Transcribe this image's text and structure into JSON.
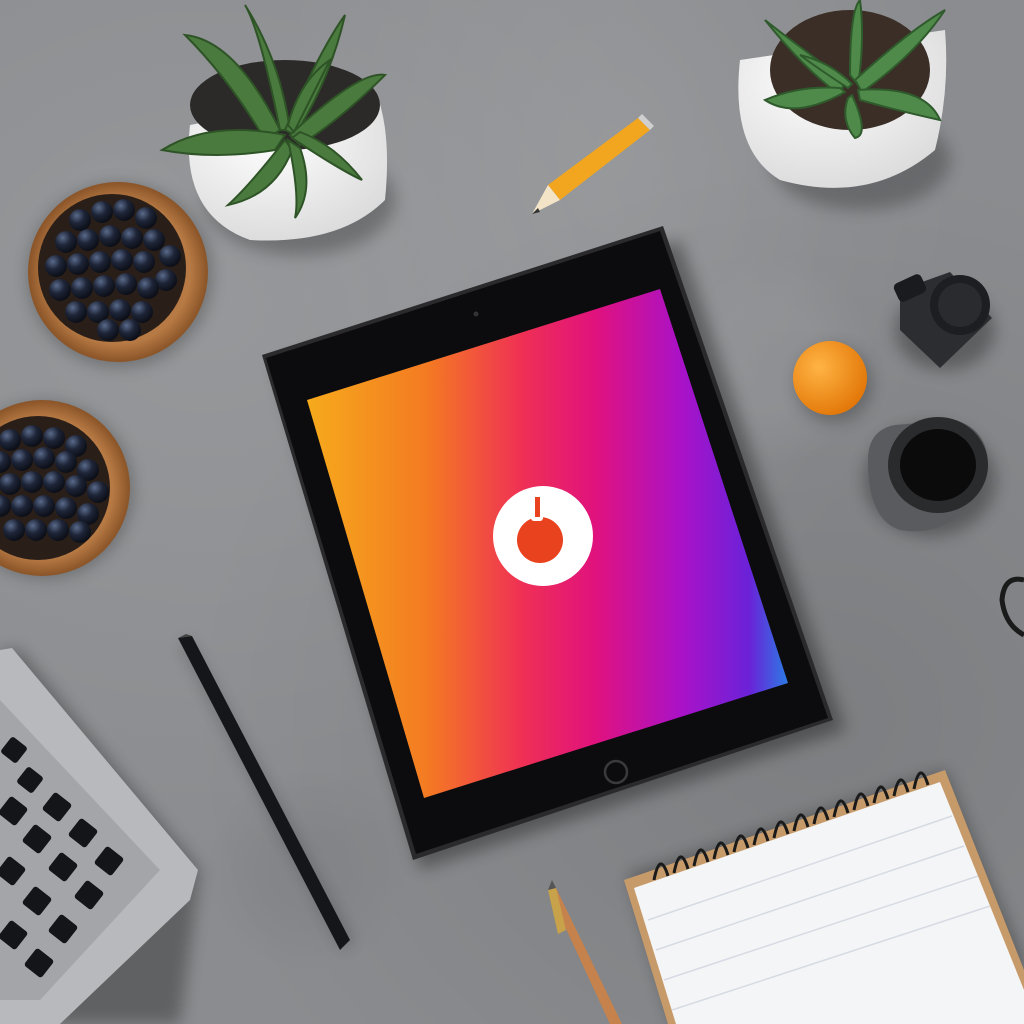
{
  "scene": {
    "description_objects": [
      "tablet",
      "succulent-plant-left",
      "succulent-plant-right",
      "pencil",
      "blueberry-bowl-top",
      "blueberry-bowl-bottom",
      "camera-lens-cap",
      "orange",
      "ink-jar",
      "stylus-pen",
      "laptop-keyboard",
      "spiral-notebook",
      "fountain-pen"
    ]
  },
  "tablet": {
    "screen_gradient": [
      "#f4a21a",
      "#f25a2a",
      "#e5147a",
      "#b50fc4",
      "#6a1fd6",
      "#2e6ee0"
    ],
    "logo_color": "#e8431e"
  },
  "colors": {
    "desk": "#8a8c8f",
    "tablet_bezel": "#0d0d0f",
    "pencil": "#f2a61f",
    "orange_fruit": "#f28c14"
  }
}
